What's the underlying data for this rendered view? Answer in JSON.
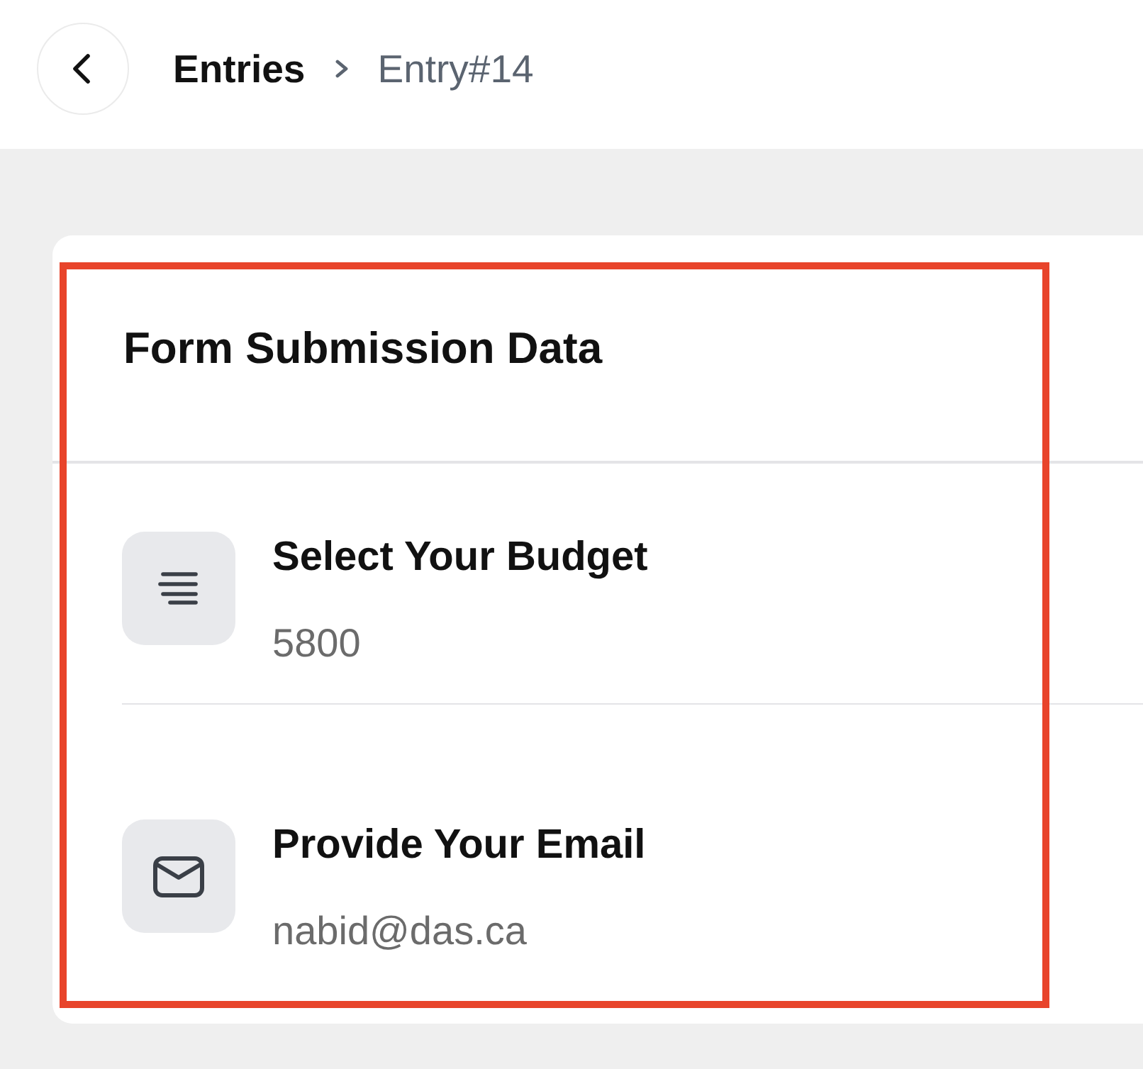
{
  "header": {
    "breadcrumb": [
      {
        "label": "Entries",
        "current": false
      },
      {
        "label": "Entry#14",
        "current": true
      }
    ]
  },
  "card": {
    "highlighted": true,
    "title": "Form Submission Data",
    "fields": [
      {
        "kind": "text",
        "label": "Select Your Budget",
        "value": "5800"
      },
      {
        "kind": "email",
        "label": "Provide Your Email",
        "value": "nabid@das.ca"
      }
    ]
  }
}
